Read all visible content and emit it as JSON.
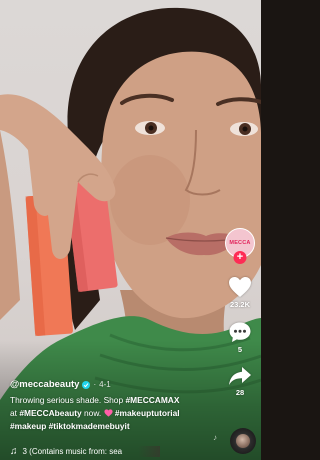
{
  "creator": {
    "avatar_text": "MECCA",
    "username": "@meccabeauty",
    "date": "4-1"
  },
  "caption": {
    "line1_plain": "Throwing serious shade. Shop ",
    "line1_tag": "#MECCAMAX",
    "line2_pre": "at ",
    "line2_tag": "#MECCAbeauty",
    "line2_mid": " now. ",
    "line2_tag2": "#makeuptutorial",
    "line3_tag1": "#makeup",
    "line3_tag2": "#tiktokmademebuyit"
  },
  "actions": {
    "likes": "23.2K",
    "comments": "5",
    "shares": "28"
  },
  "music": {
    "text": "3 (Contains music from: sea"
  },
  "icons": {
    "follow": "plus-icon",
    "like": "heart-icon",
    "comment": "comment-icon",
    "share": "share-arrow-icon",
    "music": "music-note-icon",
    "verified": "verified-check-icon",
    "emoji": "heart-emoji-icon"
  },
  "colors": {
    "accent": "#fe2c55",
    "verified": "#20d5ec",
    "brand_pink": "#f3c5cf",
    "sweater_green": "#3f8a4a",
    "lipstick_coral": "#f07856",
    "lipstick_pink": "#ec6e6c"
  }
}
